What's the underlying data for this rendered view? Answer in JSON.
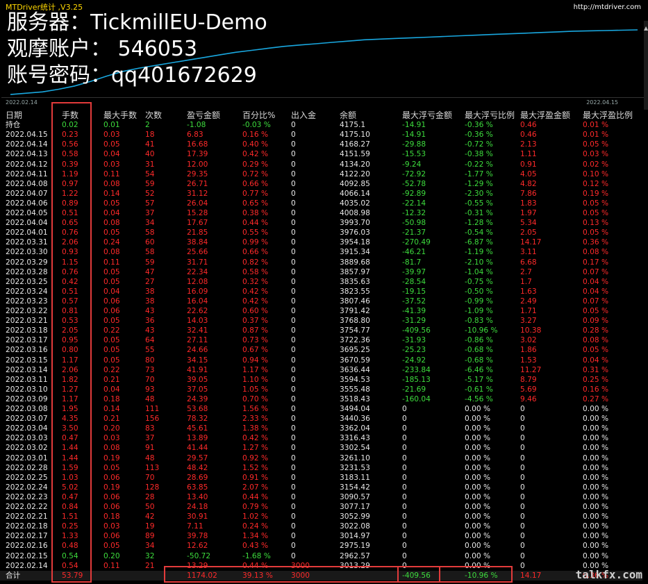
{
  "window": {
    "title": "MTDriver统计 ,V3.25",
    "url": "http://mtdriver.com"
  },
  "overlay": {
    "server": "服务器：TickmillEU-Demo",
    "account": "观摩账户： 546053",
    "password": "账号密码：qq401672629"
  },
  "chart": {
    "x_start": "2022.02.14",
    "x_end": "2022.04.15",
    "curve": [
      0.02,
      0.04,
      0.06,
      0.1,
      0.15,
      0.22,
      0.3,
      0.37,
      0.42,
      0.46,
      0.5,
      0.54,
      0.58,
      0.62,
      0.66,
      0.69,
      0.72,
      0.75,
      0.77,
      0.79,
      0.81,
      0.83,
      0.85,
      0.86,
      0.87,
      0.88,
      0.89,
      0.9,
      0.91,
      0.92,
      0.93,
      0.94,
      0.95,
      0.96,
      0.97,
      0.98,
      0.985,
      0.99,
      0.995,
      1.0
    ],
    "line_color": "#19a8e0"
  },
  "table": {
    "headers": [
      "日期",
      "手数",
      "最大手数",
      "次数",
      "盈亏金额",
      "百分比%",
      "出入金",
      "余额",
      "最大浮亏金额",
      "最大浮亏比例",
      "最大浮盈金额",
      "最大浮盈比例"
    ],
    "rows": [
      [
        "持仓",
        "0.02",
        "0.01",
        "2",
        "-1.08",
        "-0.03 %",
        "0",
        "4175.1",
        "-14.91",
        "-0.36 %",
        "0.46",
        "0.01 %"
      ],
      [
        "2022.04.15",
        "0.23",
        "0.03",
        "18",
        "6.83",
        "0.16 %",
        "0",
        "4175.10",
        "-14.91",
        "-0.36 %",
        "0.46",
        "0.01 %"
      ],
      [
        "2022.04.14",
        "0.56",
        "0.05",
        "41",
        "16.68",
        "0.40 %",
        "0",
        "4168.27",
        "-29.88",
        "-0.72 %",
        "2.13",
        "0.05 %"
      ],
      [
        "2022.04.13",
        "0.58",
        "0.04",
        "40",
        "17.39",
        "0.42 %",
        "0",
        "4151.59",
        "-15.53",
        "-0.38 %",
        "1.11",
        "0.03 %"
      ],
      [
        "2022.04.12",
        "0.39",
        "0.03",
        "31",
        "12.00",
        "0.29 %",
        "0",
        "4134.20",
        "-9.24",
        "-0.22 %",
        "0.91",
        "0.02 %"
      ],
      [
        "2022.04.11",
        "1.19",
        "0.11",
        "54",
        "29.35",
        "0.72 %",
        "0",
        "4122.20",
        "-72.92",
        "-1.77 %",
        "4.05",
        "0.10 %"
      ],
      [
        "2022.04.08",
        "0.97",
        "0.08",
        "59",
        "26.71",
        "0.66 %",
        "0",
        "4092.85",
        "-52.78",
        "-1.29 %",
        "4.82",
        "0.12 %"
      ],
      [
        "2022.04.07",
        "1.22",
        "0.14",
        "52",
        "31.12",
        "0.77 %",
        "0",
        "4066.14",
        "-92.89",
        "-2.30 %",
        "7.86",
        "0.19 %"
      ],
      [
        "2022.04.06",
        "0.89",
        "0.05",
        "57",
        "26.04",
        "0.65 %",
        "0",
        "4035.02",
        "-22.14",
        "-0.55 %",
        "1.83",
        "0.05 %"
      ],
      [
        "2022.04.05",
        "0.51",
        "0.04",
        "37",
        "15.28",
        "0.38 %",
        "0",
        "4008.98",
        "-12.32",
        "-0.31 %",
        "1.97",
        "0.05 %"
      ],
      [
        "2022.04.04",
        "0.65",
        "0.08",
        "34",
        "17.67",
        "0.44 %",
        "0",
        "3993.70",
        "-50.98",
        "-1.28 %",
        "5.34",
        "0.13 %"
      ],
      [
        "2022.04.01",
        "0.76",
        "0.05",
        "58",
        "21.85",
        "0.55 %",
        "0",
        "3976.03",
        "-21.37",
        "-0.54 %",
        "2.05",
        "0.05 %"
      ],
      [
        "2022.03.31",
        "2.06",
        "0.24",
        "60",
        "38.84",
        "0.99 %",
        "0",
        "3954.18",
        "-270.49",
        "-6.87 %",
        "14.17",
        "0.36 %"
      ],
      [
        "2022.03.30",
        "0.93",
        "0.08",
        "58",
        "25.66",
        "0.66 %",
        "0",
        "3915.34",
        "-46.21",
        "-1.19 %",
        "3.11",
        "0.08 %"
      ],
      [
        "2022.03.29",
        "1.15",
        "0.11",
        "59",
        "31.71",
        "0.82 %",
        "0",
        "3889.68",
        "-81.7",
        "-2.10 %",
        "6.68",
        "0.17 %"
      ],
      [
        "2022.03.28",
        "0.76",
        "0.05",
        "47",
        "22.34",
        "0.58 %",
        "0",
        "3857.97",
        "-39.97",
        "-1.04 %",
        "2.7",
        "0.07 %"
      ],
      [
        "2022.03.25",
        "0.42",
        "0.05",
        "27",
        "12.08",
        "0.32 %",
        "0",
        "3835.63",
        "-28.54",
        "-0.75 %",
        "1.7",
        "0.04 %"
      ],
      [
        "2022.03.24",
        "0.51",
        "0.04",
        "38",
        "16.09",
        "0.42 %",
        "0",
        "3823.55",
        "-19.15",
        "-0.50 %",
        "1.63",
        "0.04 %"
      ],
      [
        "2022.03.23",
        "0.57",
        "0.06",
        "38",
        "16.04",
        "0.42 %",
        "0",
        "3807.46",
        "-37.52",
        "-0.99 %",
        "2.49",
        "0.07 %"
      ],
      [
        "2022.03.22",
        "0.81",
        "0.06",
        "43",
        "22.62",
        "0.60 %",
        "0",
        "3791.42",
        "-41.39",
        "-1.09 %",
        "1.71",
        "0.05 %"
      ],
      [
        "2022.03.21",
        "0.53",
        "0.05",
        "36",
        "14.03",
        "0.37 %",
        "0",
        "3768.80",
        "-31.29",
        "-0.83 %",
        "3.27",
        "0.09 %"
      ],
      [
        "2022.03.18",
        "2.05",
        "0.22",
        "43",
        "32.41",
        "0.87 %",
        "0",
        "3754.77",
        "-409.56",
        "-10.96 %",
        "10.38",
        "0.28 %"
      ],
      [
        "2022.03.17",
        "0.95",
        "0.05",
        "64",
        "27.11",
        "0.73 %",
        "0",
        "3722.36",
        "-31.93",
        "-0.86 %",
        "3.02",
        "0.08 %"
      ],
      [
        "2022.03.16",
        "0.80",
        "0.05",
        "55",
        "24.66",
        "0.67 %",
        "0",
        "3695.25",
        "-25.23",
        "-0.68 %",
        "1.86",
        "0.05 %"
      ],
      [
        "2022.03.15",
        "1.17",
        "0.05",
        "80",
        "34.15",
        "0.94 %",
        "0",
        "3670.59",
        "-24.92",
        "-0.68 %",
        "1.53",
        "0.04 %"
      ],
      [
        "2022.03.14",
        "2.06",
        "0.22",
        "73",
        "41.91",
        "1.17 %",
        "0",
        "3636.44",
        "-233.84",
        "-6.46 %",
        "11.27",
        "0.31 %"
      ],
      [
        "2022.03.11",
        "1.82",
        "0.21",
        "70",
        "39.05",
        "1.10 %",
        "0",
        "3594.53",
        "-185.13",
        "-5.17 %",
        "8.79",
        "0.25 %"
      ],
      [
        "2022.03.10",
        "1.27",
        "0.04",
        "93",
        "37.05",
        "1.05 %",
        "0",
        "3555.48",
        "-21.69",
        "-0.61 %",
        "5.69",
        "0.16 %"
      ],
      [
        "2022.03.09",
        "1.17",
        "0.18",
        "48",
        "24.39",
        "0.70 %",
        "0",
        "3518.43",
        "-160.04",
        "-4.56 %",
        "9.46",
        "0.27 %"
      ],
      [
        "2022.03.08",
        "1.95",
        "0.14",
        "111",
        "53.68",
        "1.56 %",
        "0",
        "3494.04",
        "0",
        "0.00 %",
        "0",
        "0.00 %"
      ],
      [
        "2022.03.07",
        "4.35",
        "0.21",
        "156",
        "78.32",
        "2.33 %",
        "0",
        "3440.36",
        "0",
        "0.00 %",
        "0",
        "0.00 %"
      ],
      [
        "2022.03.04",
        "3.50",
        "0.20",
        "83",
        "45.61",
        "1.38 %",
        "0",
        "3362.04",
        "0",
        "0.00 %",
        "0",
        "0.00 %"
      ],
      [
        "2022.03.03",
        "0.47",
        "0.03",
        "37",
        "13.89",
        "0.42 %",
        "0",
        "3316.43",
        "0",
        "0.00 %",
        "0",
        "0.00 %"
      ],
      [
        "2022.03.02",
        "1.44",
        "0.08",
        "91",
        "41.44",
        "1.27 %",
        "0",
        "3302.54",
        "0",
        "0.00 %",
        "0",
        "0.00 %"
      ],
      [
        "2022.03.01",
        "1.44",
        "0.19",
        "48",
        "29.57",
        "0.92 %",
        "0",
        "3261.10",
        "0",
        "0.00 %",
        "0",
        "0.00 %"
      ],
      [
        "2022.02.28",
        "1.59",
        "0.05",
        "113",
        "48.42",
        "1.52 %",
        "0",
        "3231.53",
        "0",
        "0.00 %",
        "0",
        "0.00 %"
      ],
      [
        "2022.02.25",
        "1.03",
        "0.06",
        "70",
        "28.69",
        "0.91 %",
        "0",
        "3183.11",
        "0",
        "0.00 %",
        "0",
        "0.00 %"
      ],
      [
        "2022.02.24",
        "5.02",
        "0.19",
        "128",
        "63.85",
        "2.07 %",
        "0",
        "3154.42",
        "0",
        "0.00 %",
        "0",
        "0.00 %"
      ],
      [
        "2022.02.23",
        "0.47",
        "0.06",
        "28",
        "13.40",
        "0.44 %",
        "0",
        "3090.57",
        "0",
        "0.00 %",
        "0",
        "0.00 %"
      ],
      [
        "2022.02.22",
        "0.84",
        "0.06",
        "50",
        "24.18",
        "0.79 %",
        "0",
        "3077.17",
        "0",
        "0.00 %",
        "0",
        "0.00 %"
      ],
      [
        "2022.02.21",
        "1.51",
        "0.18",
        "42",
        "30.91",
        "1.02 %",
        "0",
        "3052.99",
        "0",
        "0.00 %",
        "0",
        "0.00 %"
      ],
      [
        "2022.02.18",
        "0.25",
        "0.03",
        "19",
        "7.11",
        "0.24 %",
        "0",
        "3022.08",
        "0",
        "0.00 %",
        "0",
        "0.00 %"
      ],
      [
        "2022.02.17",
        "1.33",
        "0.06",
        "89",
        "39.78",
        "1.34 %",
        "0",
        "3014.97",
        "0",
        "0.00 %",
        "0",
        "0.00 %"
      ],
      [
        "2022.02.16",
        "0.48",
        "0.05",
        "34",
        "12.62",
        "0.43 %",
        "0",
        "2975.19",
        "0",
        "0.00 %",
        "0",
        "0.00 %"
      ],
      [
        "2022.02.15",
        "0.54",
        "0.20",
        "32",
        "-50.72",
        "-1.68 %",
        "0",
        "2962.57",
        "0",
        "0.00 %",
        "0",
        "0.00 %"
      ],
      [
        "2022.02.14",
        "0.54",
        "0.11",
        "21",
        "13.29",
        "0.44 %",
        "3000",
        "3013.29",
        "0",
        "0.00 %",
        "0",
        "0.00 %"
      ]
    ],
    "total": [
      "合计",
      "53.79",
      "",
      "",
      "1174.02",
      "39.13 %",
      "3000",
      "",
      "-409.56",
      "-10.96 %",
      "14.17",
      "0.36 %"
    ]
  },
  "watermark": "talkfx.com",
  "colors": {
    "positive": "#ff2a2a",
    "negative": "#3ddc3d",
    "text": "#e8e8e8",
    "highlight_box": "#e33b3b"
  }
}
